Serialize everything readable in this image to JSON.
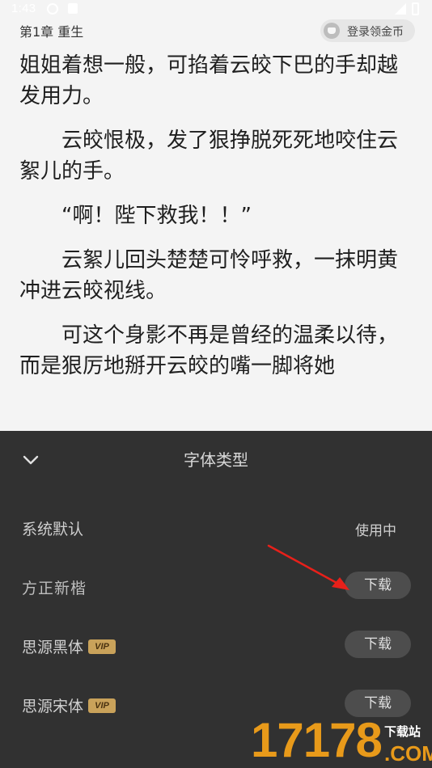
{
  "status_bar": {
    "time": "1:43"
  },
  "reader": {
    "chapter_title": "第1章 重生",
    "coin_button_label": "登录领金币",
    "paragraphs": [
      "姐姐着想一般，可掐着云皎下巴的手却越发用力。",
      "　　云皎恨极，发了狠挣脱死死地咬住云絮儿的手。",
      "　　“啊！陛下救我！！”",
      "　　云絮儿回头楚楚可怜呼救，一抹明黄冲进云皎视线。",
      "　　可这个身影不再是曾经的温柔以待，而是狠厉地掰开云皎的嘴一脚将她"
    ]
  },
  "font_sheet": {
    "title": "字体类型",
    "collapse_icon": "chevron-down-icon",
    "fonts": [
      {
        "name": "系统默认",
        "vip": false,
        "status": "使用中",
        "action": ""
      },
      {
        "name": "方正新楷",
        "vip": false,
        "status": "",
        "action": "下载"
      },
      {
        "name": "思源黑体",
        "vip": true,
        "status": "",
        "action": "下载"
      },
      {
        "name": "思源宋体",
        "vip": true,
        "status": "",
        "action": "下载"
      }
    ],
    "vip_label": "VIP"
  },
  "watermark": {
    "number": "17178",
    "label": "下载站",
    "domain": ".COM"
  },
  "colors": {
    "sheet_bg": "#313131",
    "button_bg": "#4d4d4d",
    "vip_gold": "#c9a25a",
    "annotation_red": "#e8201a",
    "watermark_orange": "#e89a1a"
  }
}
